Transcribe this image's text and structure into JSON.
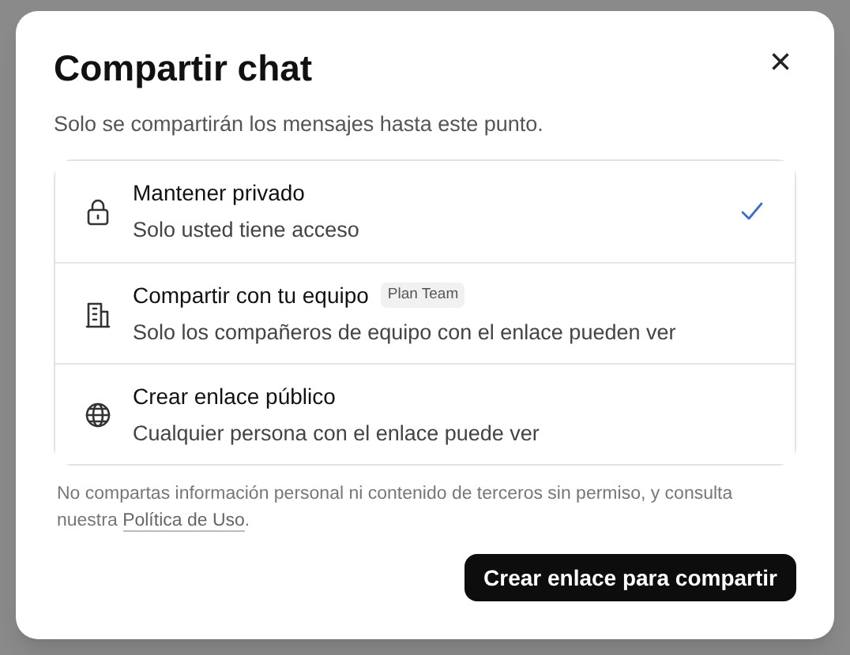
{
  "dialog": {
    "title": "Compartir chat",
    "subtitle": "Solo se compartirán los mensajes hasta este punto.",
    "close": "×"
  },
  "options": [
    {
      "kind": "lock",
      "title": "Mantener privado",
      "description": "Solo usted tiene acceso",
      "selected": true
    },
    {
      "kind": "building",
      "title": "Compartir con tu equipo",
      "badge": "Plan Team",
      "description": "Solo los compañeros de equipo con el enlace pueden ver",
      "selected": false
    },
    {
      "kind": "globe",
      "title": "Crear enlace público",
      "description": "Cualquier persona con el enlace puede ver",
      "selected": false
    }
  ],
  "note": {
    "text": "No compartas información personal ni contenido de terceros sin permiso, y consulta nuestra",
    "link": "Política de Uso",
    "end": "."
  },
  "action_button": "Crear enlace para compartir"
}
